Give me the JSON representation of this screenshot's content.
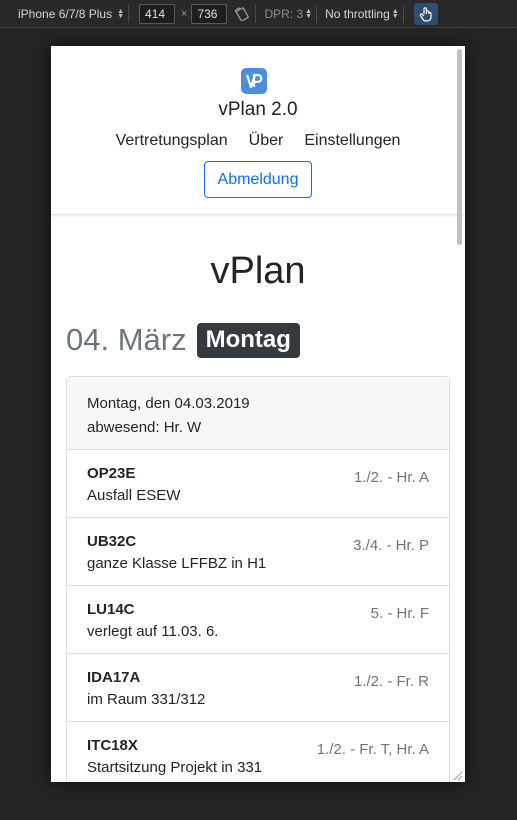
{
  "devtools": {
    "device": "iPhone 6/7/8 Plus",
    "width": "414",
    "times": "×",
    "height": "736",
    "dpr": "DPR: 3",
    "throttling": "No throttling"
  },
  "header": {
    "brand_initials": "VP",
    "brand_name": "vPlan 2.0",
    "nav": [
      "Vertretungsplan",
      "Über",
      "Einstellungen"
    ],
    "logout_label": "Abmeldung"
  },
  "colors": {
    "accent": "#0d6efd",
    "logo": "#4c8ede",
    "badge": "#343a40"
  },
  "main": {
    "title": "vPlan",
    "date": "04. März",
    "day": "Montag",
    "card": {
      "header_line1": "Montag, den 04.03.2019",
      "header_line2": "abwesend: Hr. W",
      "entries": [
        {
          "class": "OP23E",
          "note": "Ausfall ESEW",
          "meta": "1./2. - Hr. A"
        },
        {
          "class": "UB32C",
          "note": "ganze Klasse LFFBZ in H1",
          "meta": "3./4. - Hr. P"
        },
        {
          "class": "LU14C",
          "note": "verlegt auf 11.03. 6.",
          "meta": "5. - Hr. F"
        },
        {
          "class": "IDA17A",
          "note": "im Raum 331/312",
          "meta": "1./2. - Fr. R"
        },
        {
          "class": "ITC18X",
          "note": "Startsitzung Projekt in 331",
          "meta": "1./2. - Fr. T, Hr. A"
        }
      ]
    }
  }
}
